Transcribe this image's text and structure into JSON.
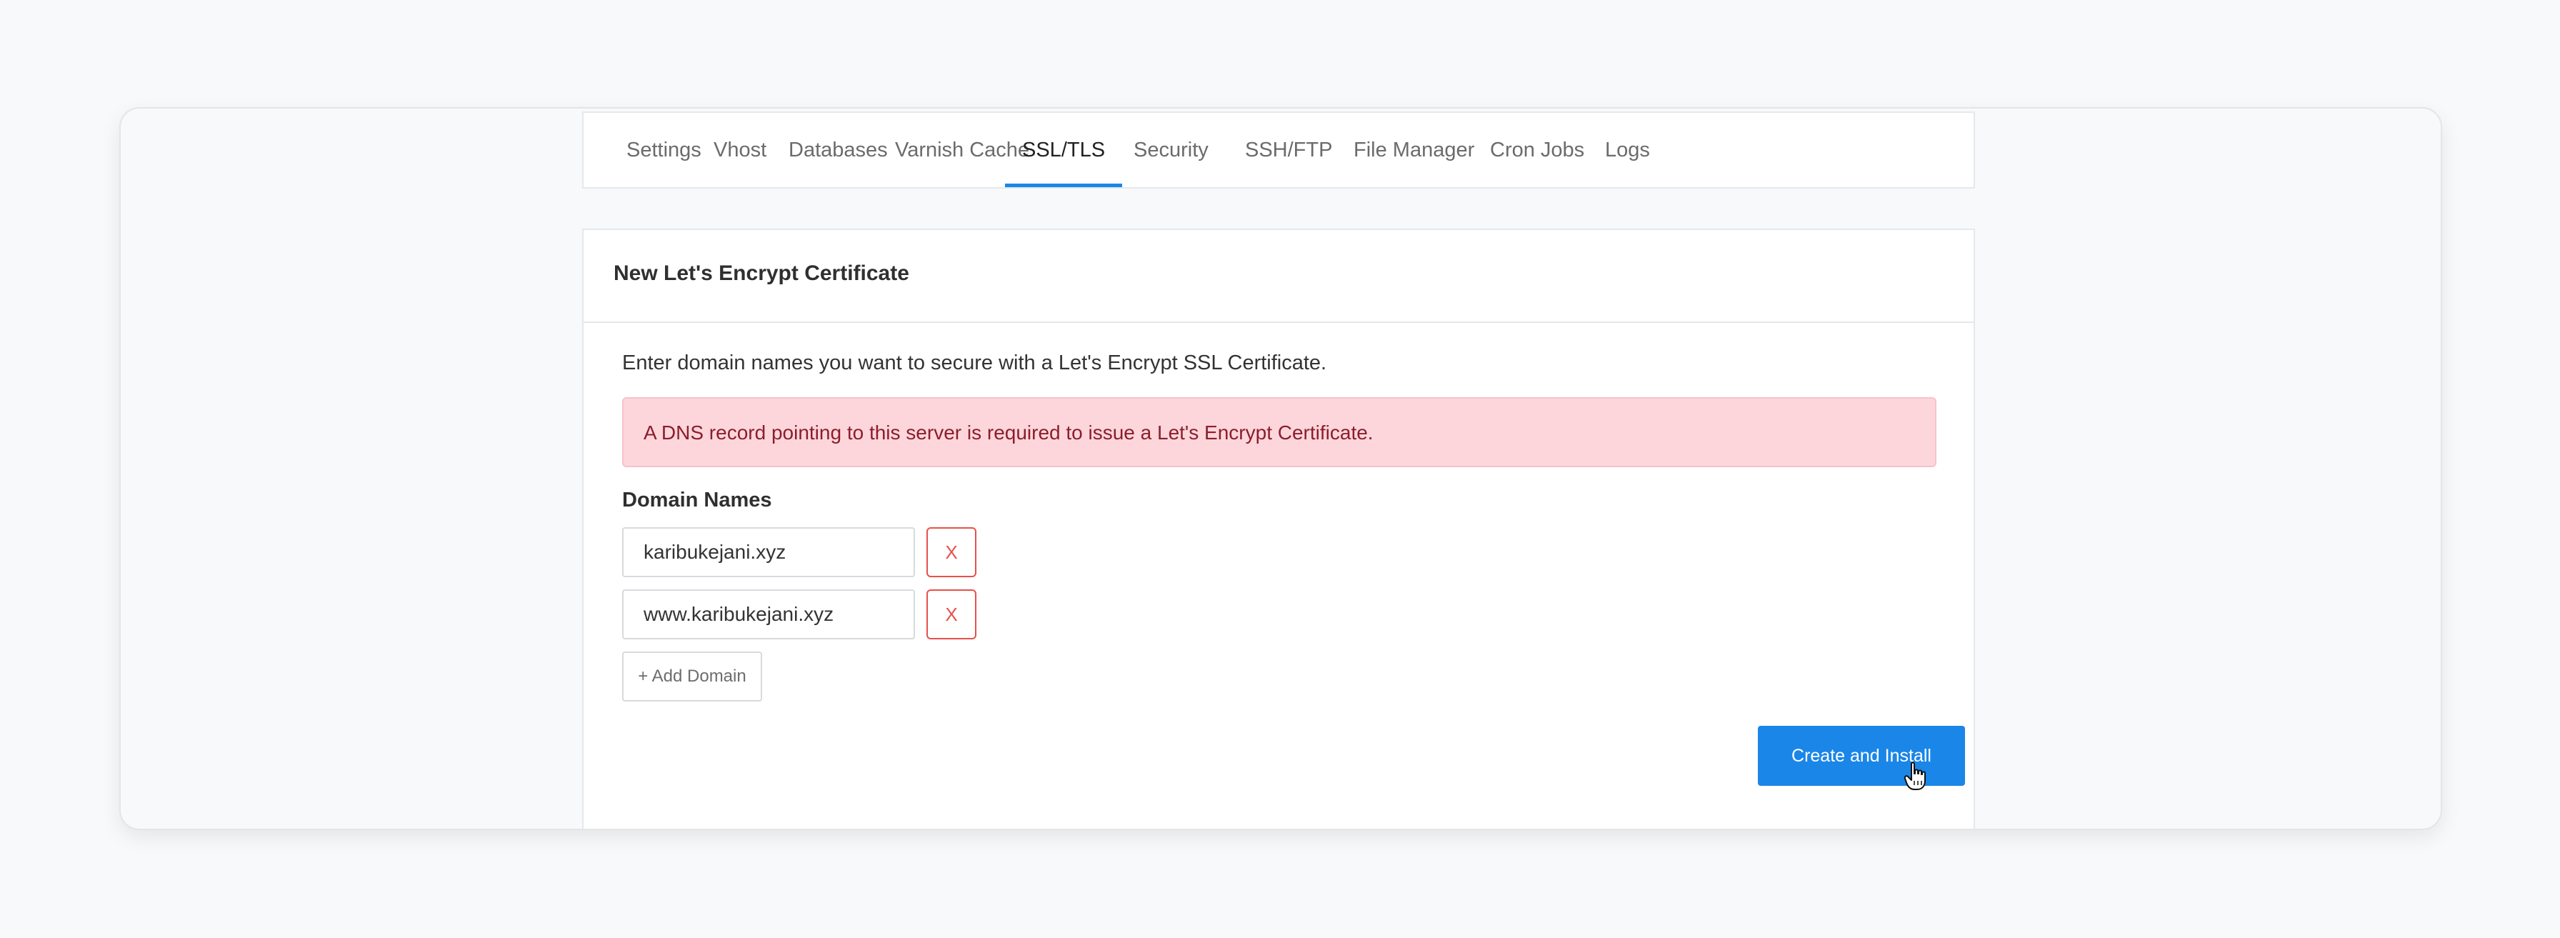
{
  "tabs": [
    {
      "label": "Settings"
    },
    {
      "label": "Vhost"
    },
    {
      "label": "Databases"
    },
    {
      "label": "Varnish Cache"
    },
    {
      "label": "SSL/TLS",
      "active": true
    },
    {
      "label": "Security"
    },
    {
      "label": "SSH/FTP"
    },
    {
      "label": "File Manager"
    },
    {
      "label": "Cron Jobs"
    },
    {
      "label": "Logs"
    }
  ],
  "card": {
    "title": "New Let's Encrypt Certificate",
    "intro": "Enter domain names you want to secure with a Let's Encrypt SSL Certificate.",
    "alert": "A DNS record pointing to this server is required to issue a Let's Encrypt Certificate.",
    "domains_label": "Domain Names",
    "domains": [
      {
        "value": "karibukejani.xyz",
        "remove_label": "X"
      },
      {
        "value": "www.karibukejani.xyz",
        "remove_label": "X"
      }
    ],
    "add_domain_label": "+ Add Domain",
    "submit_label": "Create and Install"
  },
  "colors": {
    "accent": "#1a86e8",
    "alert_bg": "#fdd6dc",
    "alert_text": "#8b1e2b",
    "danger": "#e8504a"
  }
}
